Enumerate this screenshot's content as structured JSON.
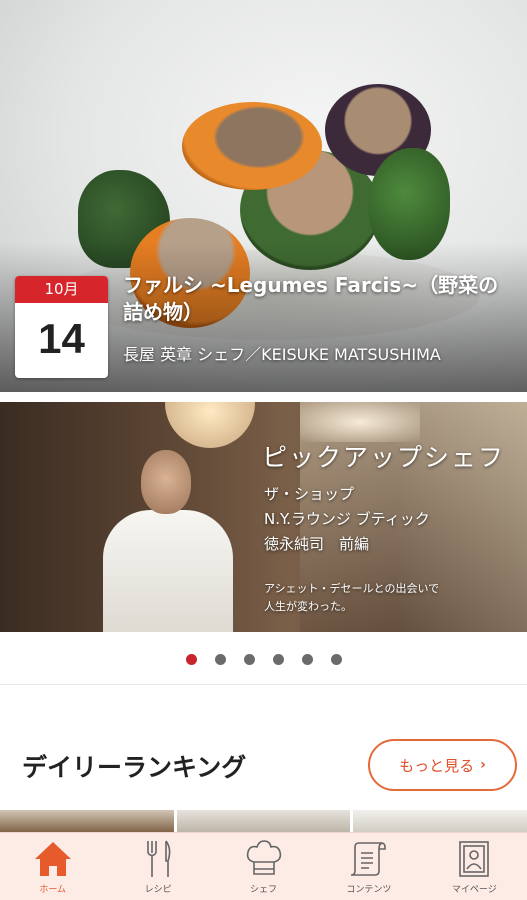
{
  "featured_recipe": {
    "date_month": "10月",
    "date_day": "14",
    "title": "ファルシ ~Legumes Farcis~（野菜の詰め物）",
    "chef": "長屋 英章 シェフ／KEISUKE MATSUSHIMA"
  },
  "pickup_banner": {
    "heading": "ピックアップシェフ",
    "lines": [
      "ザ・ショップ",
      "N.Y.ラウンジ ブティック",
      "徳永純司　前編"
    ],
    "caption_lines": [
      "アシェット・デセールとの出会いで",
      "人生が変わった。"
    ]
  },
  "carousel": {
    "page_count": 6,
    "active_index": 0,
    "active_color": "#c8242c",
    "inactive_color": "#6b6b6b"
  },
  "ranking": {
    "title": "デイリーランキング",
    "more_label": "もっと見る"
  },
  "tabbar": {
    "accent_color": "#e65a2c",
    "items": [
      {
        "label": "ホーム",
        "icon": "home-icon",
        "active": true
      },
      {
        "label": "レシピ",
        "icon": "fork-knife-icon",
        "active": false
      },
      {
        "label": "シェフ",
        "icon": "chef-hat-icon",
        "active": false
      },
      {
        "label": "コンテンツ",
        "icon": "scroll-icon",
        "active": false
      },
      {
        "label": "マイページ",
        "icon": "profile-card-icon",
        "active": false
      }
    ]
  }
}
